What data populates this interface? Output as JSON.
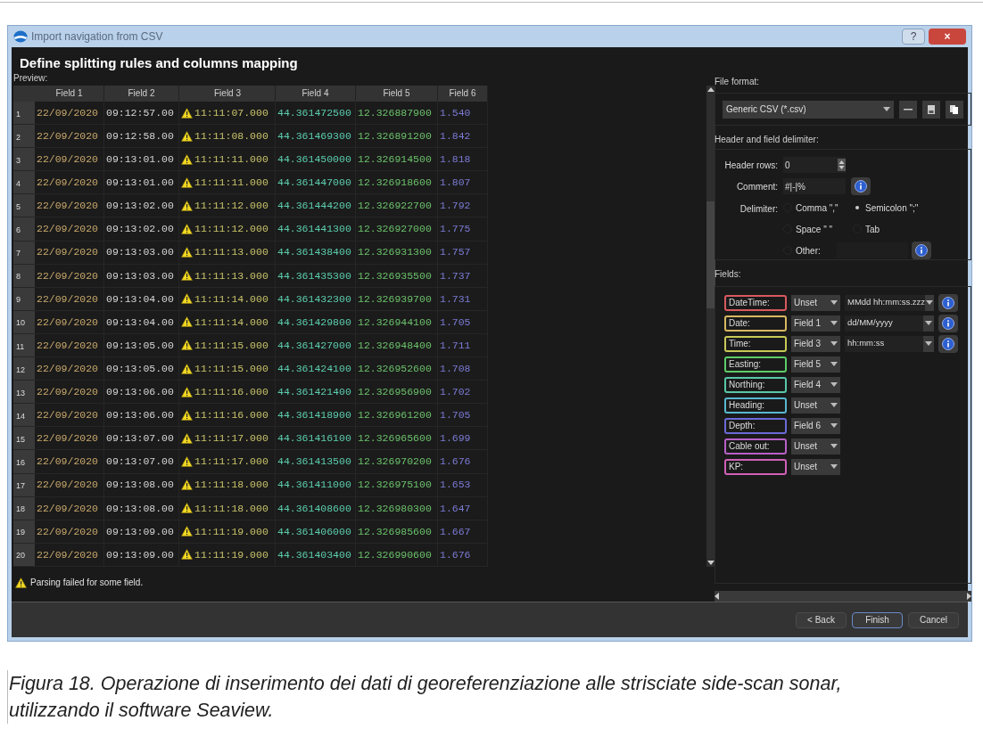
{
  "window": {
    "title": "Import navigation from CSV",
    "buttons": [
      {
        "kind": "help",
        "label": "?"
      },
      {
        "kind": "close",
        "label": "×"
      }
    ]
  },
  "heading": "Define splitting rules and columns mapping",
  "preview": {
    "label": "Preview:",
    "columns": [
      {
        "label": "Field 1",
        "color": "#c9a96c",
        "warning": false
      },
      {
        "label": "Field 2",
        "color": "#d6d6d6",
        "warning": false
      },
      {
        "label": "Field 3",
        "color": "#c9c46a",
        "warning": true
      },
      {
        "label": "Field 4",
        "color": "#5ccfae",
        "warning": false
      },
      {
        "label": "Field 5",
        "color": "#6cc36c",
        "warning": false
      },
      {
        "label": "Field 6",
        "color": "#7b7bd6",
        "warning": false
      }
    ],
    "rows": [
      {
        "number": "1",
        "cells": [
          "22/09/2020",
          "09:12:57.00",
          "11:11:07.000",
          "44.361472500",
          "12.326887900",
          "1.540"
        ]
      },
      {
        "number": "2",
        "cells": [
          "22/09/2020",
          "09:12:58.00",
          "11:11:08.000",
          "44.361469300",
          "12.326891200",
          "1.842"
        ]
      },
      {
        "number": "3",
        "cells": [
          "22/09/2020",
          "09:13:01.00",
          "11:11:11.000",
          "44.361450000",
          "12.326914500",
          "1.818"
        ]
      },
      {
        "number": "4",
        "cells": [
          "22/09/2020",
          "09:13:01.00",
          "11:11:11.000",
          "44.361447000",
          "12.326918600",
          "1.807"
        ]
      },
      {
        "number": "5",
        "cells": [
          "22/09/2020",
          "09:13:02.00",
          "11:11:12.000",
          "44.361444200",
          "12.326922700",
          "1.792"
        ]
      },
      {
        "number": "6",
        "cells": [
          "22/09/2020",
          "09:13:02.00",
          "11:11:12.000",
          "44.361441300",
          "12.326927000",
          "1.775"
        ]
      },
      {
        "number": "7",
        "cells": [
          "22/09/2020",
          "09:13:03.00",
          "11:11:13.000",
          "44.361438400",
          "12.326931300",
          "1.757"
        ]
      },
      {
        "number": "8",
        "cells": [
          "22/09/2020",
          "09:13:03.00",
          "11:11:13.000",
          "44.361435300",
          "12.326935500",
          "1.737"
        ]
      },
      {
        "number": "9",
        "cells": [
          "22/09/2020",
          "09:13:04.00",
          "11:11:14.000",
          "44.361432300",
          "12.326939700",
          "1.731"
        ]
      },
      {
        "number": "10",
        "cells": [
          "22/09/2020",
          "09:13:04.00",
          "11:11:14.000",
          "44.361429800",
          "12.326944100",
          "1.705"
        ]
      },
      {
        "number": "11",
        "cells": [
          "22/09/2020",
          "09:13:05.00",
          "11:11:15.000",
          "44.361427000",
          "12.326948400",
          "1.711"
        ]
      },
      {
        "number": "12",
        "cells": [
          "22/09/2020",
          "09:13:05.00",
          "11:11:15.000",
          "44.361424100",
          "12.326952600",
          "1.708"
        ]
      },
      {
        "number": "13",
        "cells": [
          "22/09/2020",
          "09:13:06.00",
          "11:11:16.000",
          "44.361421400",
          "12.326956900",
          "1.702"
        ]
      },
      {
        "number": "14",
        "cells": [
          "22/09/2020",
          "09:13:06.00",
          "11:11:16.000",
          "44.361418900",
          "12.326961200",
          "1.705"
        ]
      },
      {
        "number": "15",
        "cells": [
          "22/09/2020",
          "09:13:07.00",
          "11:11:17.000",
          "44.361416100",
          "12.326965600",
          "1.699"
        ]
      },
      {
        "number": "16",
        "cells": [
          "22/09/2020",
          "09:13:07.00",
          "11:11:17.000",
          "44.361413500",
          "12.326970200",
          "1.676"
        ]
      },
      {
        "number": "17",
        "cells": [
          "22/09/2020",
          "09:13:08.00",
          "11:11:18.000",
          "44.361411000",
          "12.326975100",
          "1.653"
        ]
      },
      {
        "number": "18",
        "cells": [
          "22/09/2020",
          "09:13:08.00",
          "11:11:18.000",
          "44.361408600",
          "12.326980300",
          "1.647"
        ]
      },
      {
        "number": "19",
        "cells": [
          "22/09/2020",
          "09:13:09.00",
          "11:11:19.000",
          "44.361406000",
          "12.326985600",
          "1.667"
        ]
      },
      {
        "number": "20",
        "cells": [
          "22/09/2020",
          "09:13:09.00",
          "11:11:19.000",
          "44.361403400",
          "12.326990600",
          "1.676"
        ]
      }
    ],
    "status": "Parsing failed for some field."
  },
  "file_format": {
    "label": "File format:",
    "value": "Generic CSV (*.csv)"
  },
  "delimiter_group": {
    "label": "Header and field delimiter:",
    "header_rows": {
      "label": "Header rows:",
      "value": "0"
    },
    "comment": {
      "label": "Comment:",
      "value": "#|-|%"
    },
    "delimiter_label": "Delimiter:",
    "options": [
      {
        "label": "Comma \",\"",
        "selected": false
      },
      {
        "label": "Semicolon \";\"",
        "selected": true
      },
      {
        "label": "Space \" \"",
        "selected": false
      },
      {
        "label": "Tab",
        "selected": false
      },
      {
        "label": "Other:",
        "selected": false
      }
    ]
  },
  "fields": {
    "label": "Fields:",
    "items": [
      {
        "label": "DateTime:",
        "color": "#d9595f",
        "source": "Unset",
        "format": "MMdd hh:mm:ss.zzz"
      },
      {
        "label": "Date:",
        "color": "#d8b860",
        "source": "Field 1",
        "format": "dd/MM/yyyy"
      },
      {
        "label": "Time:",
        "color": "#c8c858",
        "source": "Field 3",
        "format": "hh:mm:ss"
      },
      {
        "label": "Easting:",
        "color": "#5ccc68",
        "source": "Field 5"
      },
      {
        "label": "Northing:",
        "color": "#58c8a8",
        "source": "Field 4"
      },
      {
        "label": "Heading:",
        "color": "#58b8d0",
        "source": "Unset"
      },
      {
        "label": "Depth:",
        "color": "#6a6ad8",
        "source": "Field 6"
      },
      {
        "label": "Cable out:",
        "color": "#b860c8",
        "source": "Unset"
      },
      {
        "label": "KP:",
        "color": "#d060b8",
        "source": "Unset"
      }
    ]
  },
  "footer_buttons": [
    {
      "label": "< Back",
      "selected": false
    },
    {
      "label": "Finish",
      "selected": true
    },
    {
      "label": "Cancel",
      "selected": false
    }
  ],
  "caption": "Figura 18. Operazione di inserimento dei dati di georeferenziazione alle strisciate side-scan sonar, utilizzando il software Seaview."
}
